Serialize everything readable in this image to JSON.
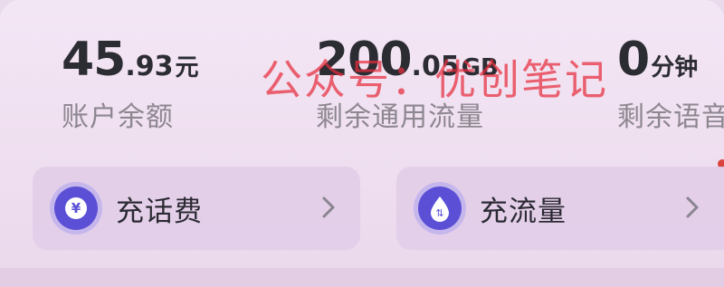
{
  "stats": {
    "balance": {
      "integer": "45",
      "decimal": ".93",
      "unit": "元",
      "label": "账户余额"
    },
    "data": {
      "integer": "200",
      "decimal": ".05",
      "unit": "GB",
      "label": "剩余通用流量"
    },
    "voice": {
      "integer": "0",
      "decimal": "",
      "unit": "分钟",
      "label": "剩余语音"
    }
  },
  "actions": {
    "recharge_fee": {
      "label": "充话费",
      "icon": "yuan-coin-icon",
      "icon_glyph": "¥"
    },
    "recharge_data": {
      "label": "充流量",
      "icon": "droplet-icon",
      "icon_glyph": "⇅"
    }
  },
  "watermark": {
    "text": "公众号：优创笔记"
  },
  "colors": {
    "accent": "#5b4fd6",
    "watermark": "#e62d3c",
    "notification_dot": "#d9453e"
  }
}
